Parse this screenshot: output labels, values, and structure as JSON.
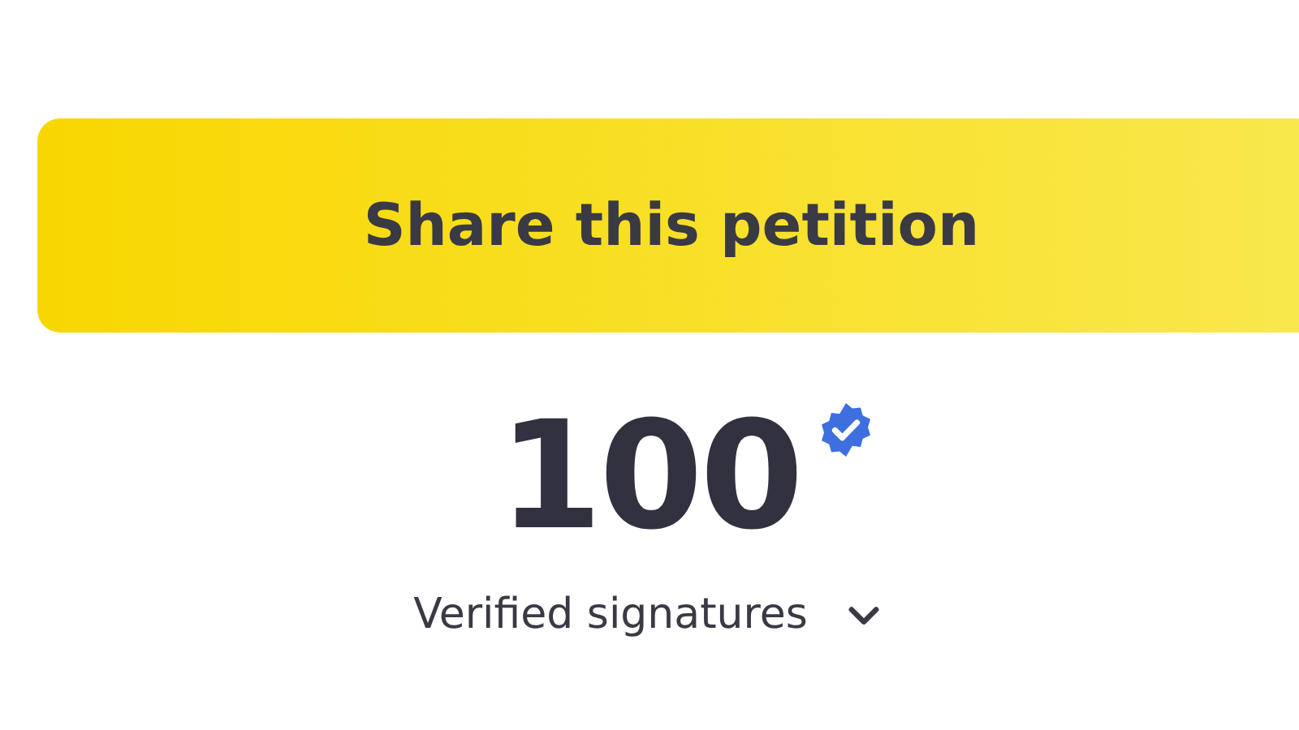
{
  "share_button": {
    "label": "Share this petition"
  },
  "signatures": {
    "count": "100",
    "verified": true,
    "label": "Verified signatures",
    "expanded": false
  }
}
